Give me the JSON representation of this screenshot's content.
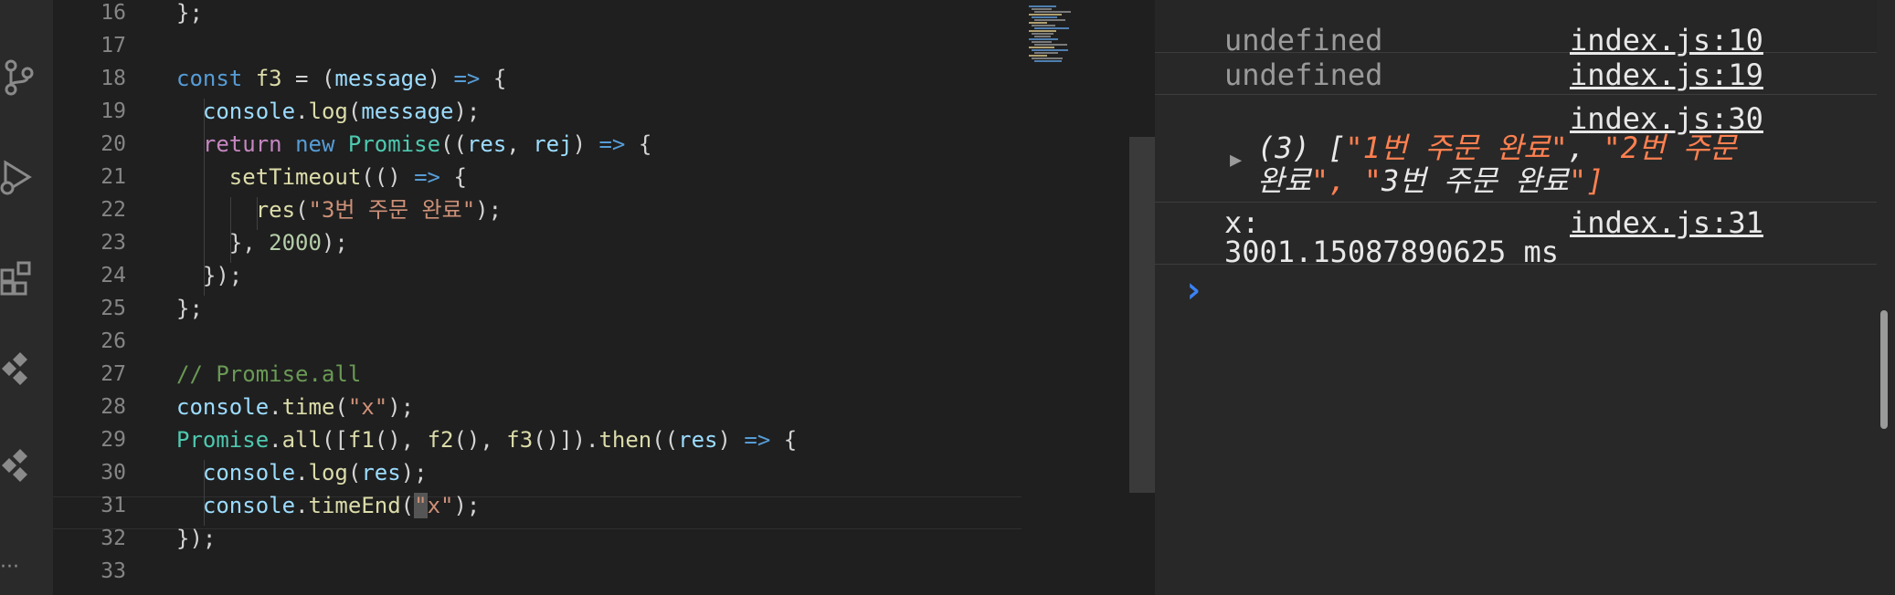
{
  "activity_bar": {
    "icons": [
      "source-control-icon",
      "run-debug-icon",
      "extensions-icon",
      "remote-icon",
      "remote-icon",
      "more-icon"
    ],
    "more_label": "···"
  },
  "editor": {
    "lines": [
      {
        "n": "16",
        "html": "<span class='pu'>};</span>"
      },
      {
        "n": "17",
        "html": ""
      },
      {
        "n": "18",
        "html": "<span class='kw'>const</span> <span class='fn'>f3</span> = (<span class='vr'>message</span>) <span class='kw'>=&gt;</span> {"
      },
      {
        "n": "19",
        "html": "  <span class='vr'>console</span>.<span class='fn'>log</span>(<span class='vr'>message</span>);"
      },
      {
        "n": "20",
        "html": "  <span class='kw2'>return</span> <span class='kw'>new</span> <span class='cls'>Promise</span>((<span class='vr'>res</span>, <span class='vr'>rej</span>) <span class='kw'>=&gt;</span> {"
      },
      {
        "n": "21",
        "html": "    <span class='fn'>setTimeout</span>(() <span class='kw'>=&gt;</span> {"
      },
      {
        "n": "22",
        "html": "      <span class='fn'>res</span>(<span class='st'>\"3번 주문 완료\"</span>);"
      },
      {
        "n": "23",
        "html": "    }, <span class='nm'>2000</span>);"
      },
      {
        "n": "24",
        "html": "  });"
      },
      {
        "n": "25",
        "html": "};"
      },
      {
        "n": "26",
        "html": ""
      },
      {
        "n": "27",
        "html": "<span class='cm'>// Promise.all</span>"
      },
      {
        "n": "28",
        "html": "<span class='vr'>console</span>.<span class='fn'>time</span>(<span class='st'>\"x\"</span>);"
      },
      {
        "n": "29",
        "html": "<span class='cls'>Promise</span>.<span class='fn'>all</span>([<span class='fn'>f1</span>(), <span class='fn'>f2</span>(), <span class='fn'>f3</span>()]).<span class='fn'>then</span>((<span class='vr'>res</span>) <span class='kw'>=&gt;</span> {"
      },
      {
        "n": "30",
        "html": "  <span class='vr'>console</span>.<span class='fn'>log</span>(<span class='vr'>res</span>);"
      },
      {
        "n": "31",
        "html": "  <span class='vr'>console</span>.<span class='fn'>timeEnd</span>(<span class='st' style='background:#555'>\"</span><span class='st'>x\"</span>);"
      },
      {
        "n": "32",
        "html": "});"
      },
      {
        "n": "33",
        "html": ""
      }
    ]
  },
  "console": {
    "rows": [
      {
        "text": "undefined",
        "source": "index.js:10"
      },
      {
        "text": "undefined",
        "source": "index.js:19"
      },
      {
        "source": "index.js:30",
        "expand_arrow": "▶",
        "line1": "(3) [\"1번 주문 완료\", \"2번 주문",
        "line2": "완료\", \"3번 주문 완료\"]"
      },
      {
        "label": "x:",
        "source": "index.js:31",
        "value": "3001.15087890625 ms"
      }
    ],
    "prompt": "›"
  },
  "colors": {
    "accent_prompt": "#3b82f6",
    "string_orange": "#ff8050"
  }
}
